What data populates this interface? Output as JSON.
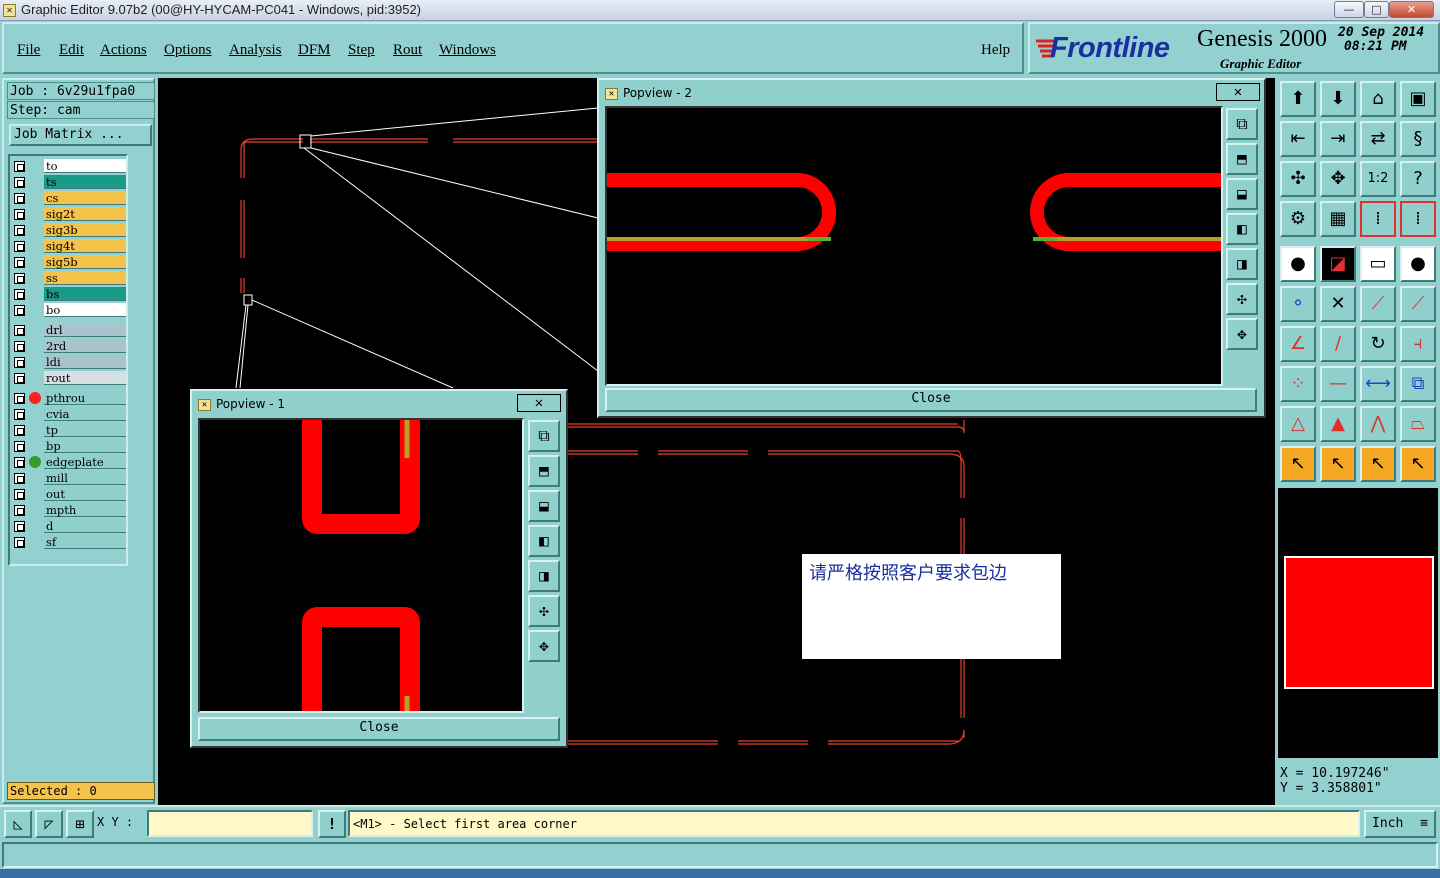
{
  "window": {
    "title": "Graphic Editor 9.07b2 (00@HY-HYCAM-PC041 - Windows, pid:3952)",
    "minimize": "—",
    "maximize": "□",
    "close": "✕"
  },
  "menu": {
    "items": [
      "File",
      "Edit",
      "Actions",
      "Options",
      "Analysis",
      "DFM",
      "Step",
      "Rout",
      "Windows"
    ],
    "help": "Help"
  },
  "brand": {
    "logo": "Frontline",
    "product": "Genesis 2000",
    "subtitle": "Graphic Editor",
    "date_line1": "20  Sep  2014",
    "date_line2": "08:21  PM"
  },
  "job": {
    "job_line": "Job  :  6v29u1fpa0",
    "step_line": "Step:  cam",
    "matrix_button": "Job Matrix ..."
  },
  "layers": [
    {
      "name": "to",
      "color": "#ffffff"
    },
    {
      "name": "ts",
      "color": "#1a9a88"
    },
    {
      "name": "cs",
      "color": "#f5c24c"
    },
    {
      "name": "sig2t",
      "color": "#f5c24c"
    },
    {
      "name": "sig3b",
      "color": "#f5c24c"
    },
    {
      "name": "sig4t",
      "color": "#f5c24c"
    },
    {
      "name": "sig5b",
      "color": "#f5c24c"
    },
    {
      "name": "ss",
      "color": "#f5c24c"
    },
    {
      "name": "bs",
      "color": "#1a9a88"
    },
    {
      "name": "bo",
      "color": "#ffffff"
    },
    {
      "name": "drl",
      "color": "#a9c4cc"
    },
    {
      "name": "2rd",
      "color": "#a9c4cc"
    },
    {
      "name": "ldi",
      "color": "#a9c4cc"
    },
    {
      "name": "rout",
      "color": "#d6dfe2"
    },
    {
      "name": "pthrou",
      "color": "#8fd0cd",
      "dot": "#ff2020"
    },
    {
      "name": "cvia",
      "color": "#8fd0cd"
    },
    {
      "name": "tp",
      "color": "#8fd0cd"
    },
    {
      "name": "bp",
      "color": "#8fd0cd"
    },
    {
      "name": "edgeplate",
      "color": "#8fd0cd",
      "dot": "#3a9a30"
    },
    {
      "name": "mill",
      "color": "#8fd0cd"
    },
    {
      "name": "out",
      "color": "#8fd0cd"
    },
    {
      "name": "mpth",
      "color": "#8fd0cd"
    },
    {
      "name": "d",
      "color": "#8fd0cd"
    },
    {
      "name": "sf",
      "color": "#8fd0cd"
    }
  ],
  "selected": "Selected : 0",
  "popview1": {
    "title": "Popview - 1",
    "close": "Close"
  },
  "popview2": {
    "title": "Popview - 2",
    "close": "Close"
  },
  "note": "请严格按照客户要求包边",
  "coords": {
    "x": "X  =  10.197246\"",
    "y": "Y  =  3.358801\""
  },
  "bottom": {
    "xy_label": "X Y :",
    "xy_value": "",
    "prompt": "<M1> - Select first area corner",
    "unit": "Inch"
  }
}
